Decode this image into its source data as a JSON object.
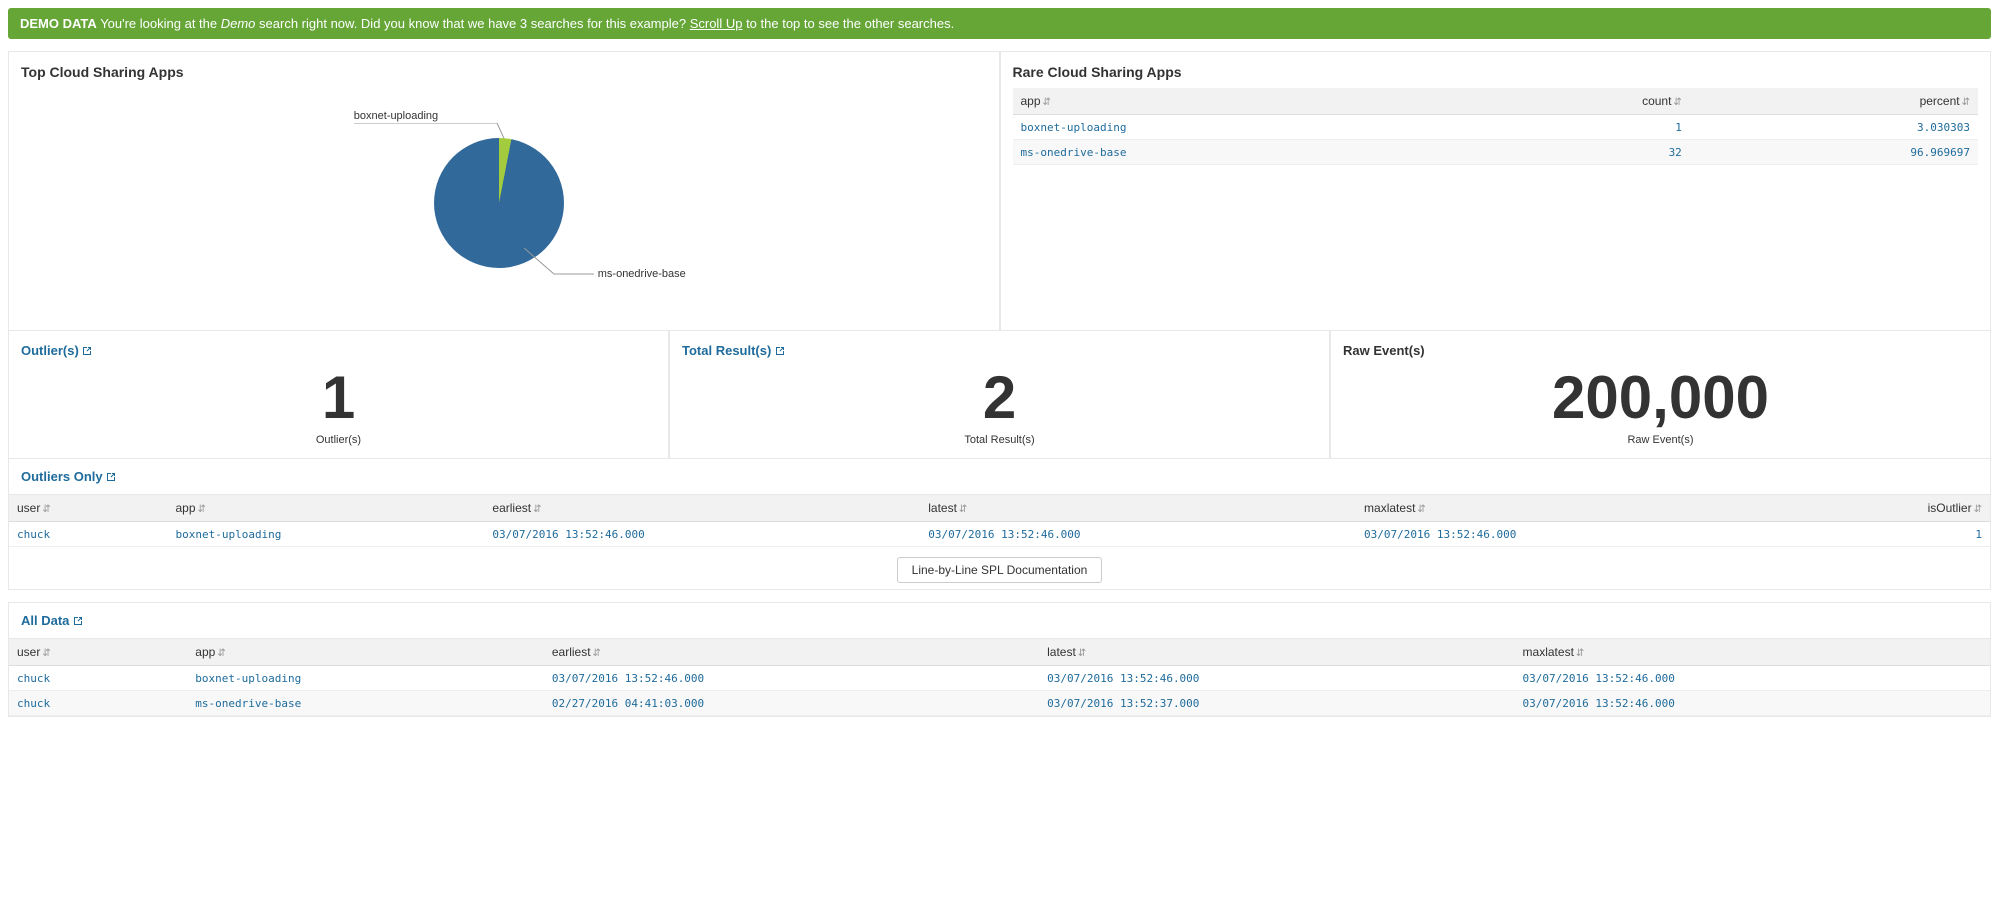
{
  "banner": {
    "prefix": "DEMO DATA",
    "part1": "You're looking at the ",
    "italic": "Demo",
    "part2": " search right now. Did you know that we have 3 searches for this example? ",
    "link": "Scroll Up",
    "part3": " to the top to see the other searches."
  },
  "chart_data": {
    "type": "pie",
    "title": "Top Cloud Sharing Apps",
    "slices": [
      {
        "label": "boxnet-uploading",
        "value": 1,
        "percent": 3.030303,
        "color": "#a2cc3e"
      },
      {
        "label": "ms-onedrive-base",
        "value": 32,
        "percent": 96.969697,
        "color": "#31699b"
      }
    ]
  },
  "top_panel_title": "Top Cloud Sharing Apps",
  "pie_label_top": "boxnet-uploading",
  "pie_label_bottom": "ms-onedrive-base",
  "rare_panel": {
    "title": "Rare Cloud Sharing Apps",
    "headers": {
      "app": "app",
      "count": "count",
      "percent": "percent"
    },
    "rows": [
      {
        "app": "boxnet-uploading",
        "count": "1",
        "percent": "3.030303"
      },
      {
        "app": "ms-onedrive-base",
        "count": "32",
        "percent": "96.969697"
      }
    ]
  },
  "stats": {
    "outliers": {
      "title": "Outlier(s)",
      "value": "1",
      "sub": "Outlier(s)"
    },
    "total": {
      "title": "Total Result(s)",
      "value": "2",
      "sub": "Total Result(s)"
    },
    "raw": {
      "title": "Raw Event(s)",
      "value": "200,000",
      "sub": "Raw Event(s)"
    }
  },
  "outliers_only": {
    "title": "Outliers Only",
    "headers": {
      "user": "user",
      "app": "app",
      "earliest": "earliest",
      "latest": "latest",
      "maxlatest": "maxlatest",
      "isOutlier": "isOutlier"
    },
    "rows": [
      {
        "user": "chuck",
        "app": "boxnet-uploading",
        "earliest": "03/07/2016 13:52:46.000",
        "latest": "03/07/2016 13:52:46.000",
        "maxlatest": "03/07/2016 13:52:46.000",
        "isOutlier": "1"
      }
    ]
  },
  "spl_button": "Line-by-Line SPL Documentation",
  "all_data": {
    "title": "All Data",
    "headers": {
      "user": "user",
      "app": "app",
      "earliest": "earliest",
      "latest": "latest",
      "maxlatest": "maxlatest"
    },
    "rows": [
      {
        "user": "chuck",
        "app": "boxnet-uploading",
        "earliest": "03/07/2016 13:52:46.000",
        "latest": "03/07/2016 13:52:46.000",
        "maxlatest": "03/07/2016 13:52:46.000"
      },
      {
        "user": "chuck",
        "app": "ms-onedrive-base",
        "earliest": "02/27/2016 04:41:03.000",
        "latest": "03/07/2016 13:52:37.000",
        "maxlatest": "03/07/2016 13:52:46.000"
      }
    ]
  }
}
